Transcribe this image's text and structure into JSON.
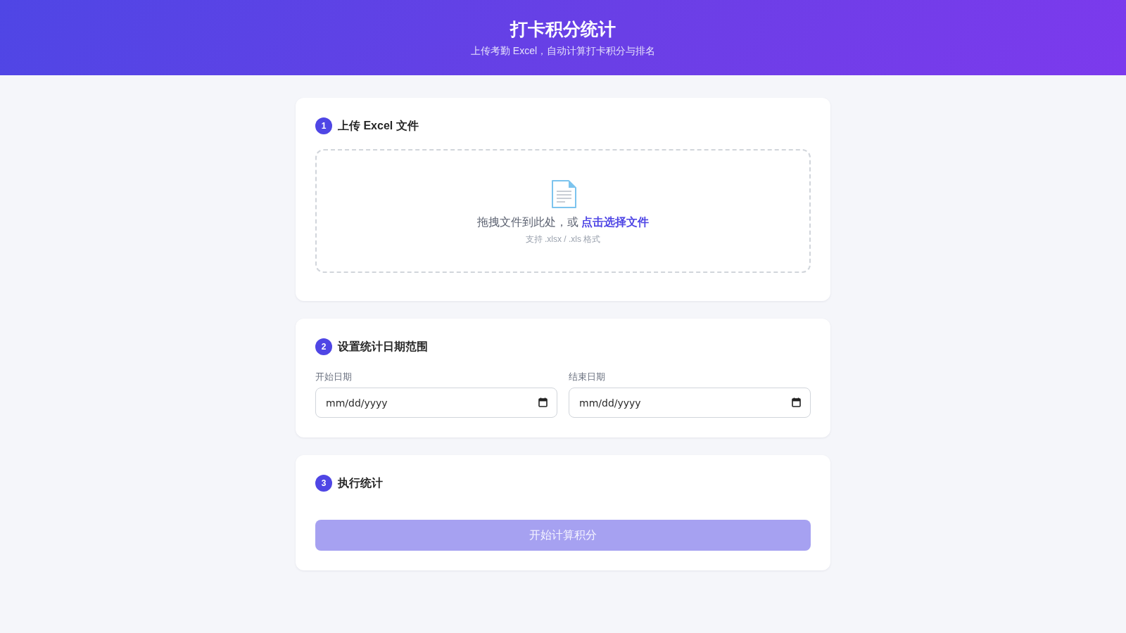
{
  "header": {
    "title": "打卡积分统计",
    "subtitle": "上传考勤 Excel，自动计算打卡积分与排名"
  },
  "steps": [
    {
      "kind": "upload",
      "number": "1",
      "title": "上传 Excel 文件",
      "dropzone": {
        "prompt": "拖拽文件到此处，或",
        "link": "点击选择文件",
        "hint": "支持 .xlsx / .xls 格式"
      }
    },
    {
      "kind": "dates",
      "number": "2",
      "title": "设置统计日期范围",
      "fields": [
        {
          "label": "开始日期",
          "placeholder": "mm/dd/yyyy"
        },
        {
          "label": "结束日期",
          "placeholder": "mm/dd/yyyy"
        }
      ]
    },
    {
      "kind": "action",
      "number": "3",
      "title": "执行统计",
      "button": {
        "label": "开始计算积分",
        "disabled": true
      }
    }
  ]
}
